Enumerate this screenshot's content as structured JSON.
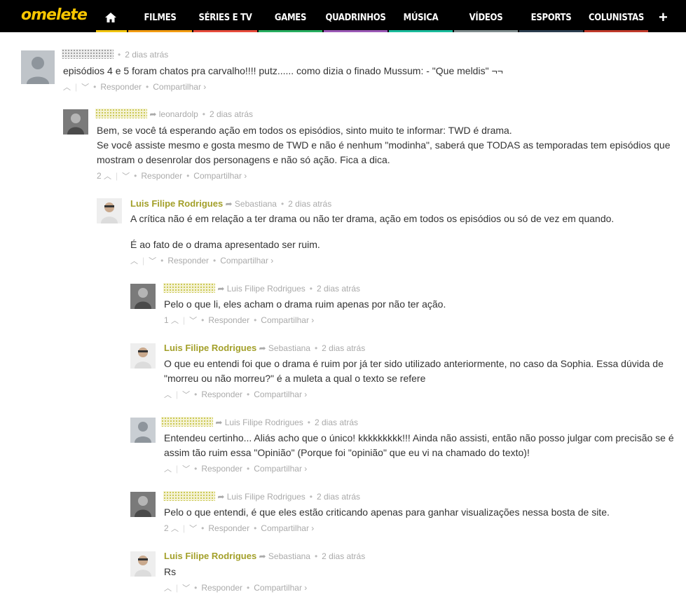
{
  "nav": {
    "logo": "omelete",
    "items": [
      {
        "label": "FILMES",
        "color": "#f39c12"
      },
      {
        "label": "SÉRIES E TV",
        "color": "#e74c3c"
      },
      {
        "label": "GAMES",
        "color": "#27ae60"
      },
      {
        "label": "QUADRINHOS",
        "color": "#9b59b6"
      },
      {
        "label": "MÚSICA",
        "color": "#1abc9c"
      },
      {
        "label": "VÍDEOS",
        "color": "#7f8c8d"
      },
      {
        "label": "ESPORTS",
        "color": "#2c3e50"
      },
      {
        "label": "COLUNISTAS",
        "color": "#c0392b"
      }
    ],
    "home_bar_color": "#f1c40f",
    "plus": "+"
  },
  "comments": [
    {
      "author": "",
      "reply_to": "",
      "time": "2 dias atrás",
      "votes": "",
      "text": [
        "episódios 4 e 5 foram chatos pra carvalho!!!! putz...... como dizia o finado Mussum: - \"Que meldis\" ¬¬"
      ]
    },
    {
      "author": "",
      "reply_to": "leonardolp",
      "time": "2 dias atrás",
      "votes": "2",
      "text": [
        "Bem, se você tá esperando ação em todos os episódios, sinto muito te informar: TWD é drama.",
        "Se você assiste mesmo e gosta mesmo de TWD e não é nenhum \"modinha\", saberá que TODAS as temporadas tem episódios que mostram o desenrolar dos personagens e não só ação. Fica a dica."
      ]
    },
    {
      "author": "Luis Filipe Rodrigues",
      "reply_to": "Sebastiana",
      "time": "2 dias atrás",
      "votes": "",
      "text": [
        "A crítica não é em relação a ter drama ou não ter drama, ação em todos os episódios ou só de vez em quando.",
        "É ao fato de o drama apresentado ser ruim."
      ]
    },
    {
      "author": "",
      "reply_to": "Luis Filipe Rodrigues",
      "time": "2 dias atrás",
      "votes": "1",
      "text": [
        "Pelo o que li, eles acham o drama ruim apenas por não ter ação."
      ]
    },
    {
      "author": "Luis Filipe Rodrigues",
      "reply_to": "Sebastiana",
      "time": "2 dias atrás",
      "votes": "",
      "text": [
        "O que eu entendi foi que o drama é ruim por já ter sido utilizado anteriormente, no caso da Sophia. Essa dúvida de \"morreu ou não morreu?\" é a muleta a qual o texto se refere"
      ]
    },
    {
      "author": "",
      "reply_to": "Luis Filipe Rodrigues",
      "time": "2 dias atrás",
      "votes": "",
      "text": [
        "Entendeu certinho... Aliás acho que o único! kkkkkkkkk!!! Ainda não assisti, então não posso julgar com precisão se é assim tão ruim essa \"Opinião\" (Porque foi \"opinião\" que eu vi na chamado do texto)!"
      ]
    },
    {
      "author": "",
      "reply_to": "Luis Filipe Rodrigues",
      "time": "2 dias atrás",
      "votes": "2",
      "text": [
        "Pelo o que entendi, é que eles estão criticando apenas para ganhar visualizações nessa bosta de site."
      ]
    },
    {
      "author": "Luis Filipe Rodrigues",
      "reply_to": "Sebastiana",
      "time": "2 dias atrás",
      "votes": "",
      "text": [
        "Rs"
      ]
    }
  ],
  "actions": {
    "reply": "Responder",
    "share": "Compartilhar ›",
    "dot": "•",
    "up": "^",
    "down": "v"
  }
}
